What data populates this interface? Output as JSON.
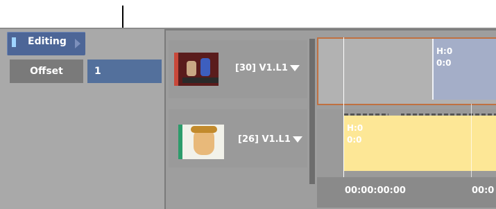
{
  "mode_button": {
    "label": "Editing"
  },
  "offset": {
    "label": "Offset",
    "value": "1"
  },
  "tracks": [
    {
      "name": "[30] V1.L1",
      "clip": {
        "line1": "H:0",
        "line2": "0:0"
      }
    },
    {
      "name": "[26] V1.L1",
      "clip": {
        "line1": "H:0",
        "line2": "0:0"
      }
    }
  ],
  "ruler": {
    "timecodes": [
      "00:00:00:00",
      "00:0"
    ]
  },
  "colors": {
    "accent": "#4d6697",
    "video_clip": "#a4aec8",
    "audio_clip": "#fde796",
    "selection": "#c07040"
  }
}
